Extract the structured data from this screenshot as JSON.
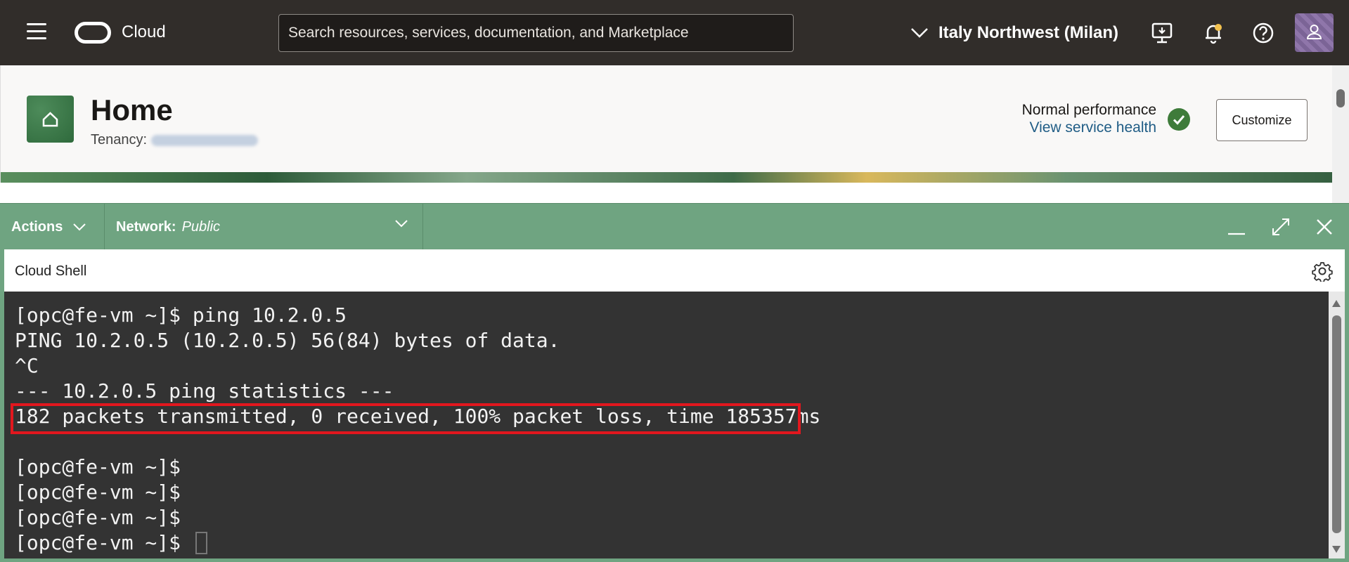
{
  "topbar": {
    "brand": "Cloud",
    "search_placeholder": "Search resources, services, documentation, and Marketplace",
    "region": "Italy Northwest (Milan)",
    "icons": [
      "hamburger-icon",
      "cloud-logo-icon",
      "chevron-down-icon",
      "monitor-icon",
      "bell-icon",
      "help-icon",
      "user-icon"
    ]
  },
  "home": {
    "title": "Home",
    "tenancy_label": "Tenancy:",
    "performance_status": "Normal performance",
    "performance_link": "View service health",
    "customize_label": "Customize"
  },
  "shell": {
    "actions_label": "Actions",
    "network_key": "Network:",
    "network_value": "Public",
    "title": "Cloud Shell",
    "terminal_lines": [
      "[opc@fe-vm ~]$ ping 10.2.0.5",
      "PING 10.2.0.5 (10.2.0.5) 56(84) bytes of data.",
      "^C",
      "--- 10.2.0.5 ping statistics ---",
      "182 packets transmitted, 0 received, 100% packet loss, time 185357ms",
      "",
      "[opc@fe-vm ~]$",
      "[opc@fe-vm ~]$",
      "[opc@fe-vm ~]$",
      "[opc@fe-vm ~]$ "
    ]
  },
  "colors": {
    "topbar": "#312d2a",
    "shell_accent": "#6fa481",
    "terminal_bg": "#333333",
    "highlight": "#e2171e",
    "link": "#1f5c85",
    "status_ok": "#3e7b3a"
  }
}
